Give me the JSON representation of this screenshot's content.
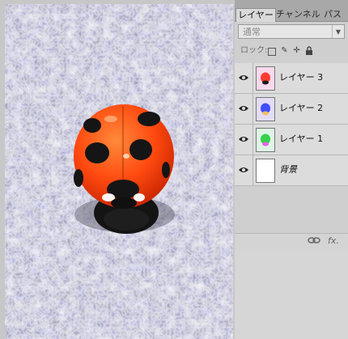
{
  "panel": {
    "tabs": [
      "レイヤー",
      "チャンネル",
      "パス"
    ],
    "blend_mode": "通常",
    "lock_label": "ロック:",
    "lock_icons": [
      "transparency-lock-icon",
      "paint-lock-icon",
      "move-lock-icon",
      "all-lock-icon"
    ],
    "layers": [
      {
        "name": "レイヤー 3",
        "thumb_color": "#ff3b2f"
      },
      {
        "name": "レイヤー 2",
        "thumb_color": "#3f4dff"
      },
      {
        "name": "レイヤー 1",
        "thumb_color": "#35d24a"
      },
      {
        "name": "背景",
        "thumb_color": "#ffffff"
      }
    ],
    "footer_icons": [
      "link-icon",
      "fx-icon"
    ],
    "footer_fx": "fx."
  },
  "colors": {
    "ladybug_orange": "#ff5a14",
    "spot_black": "#111111"
  }
}
